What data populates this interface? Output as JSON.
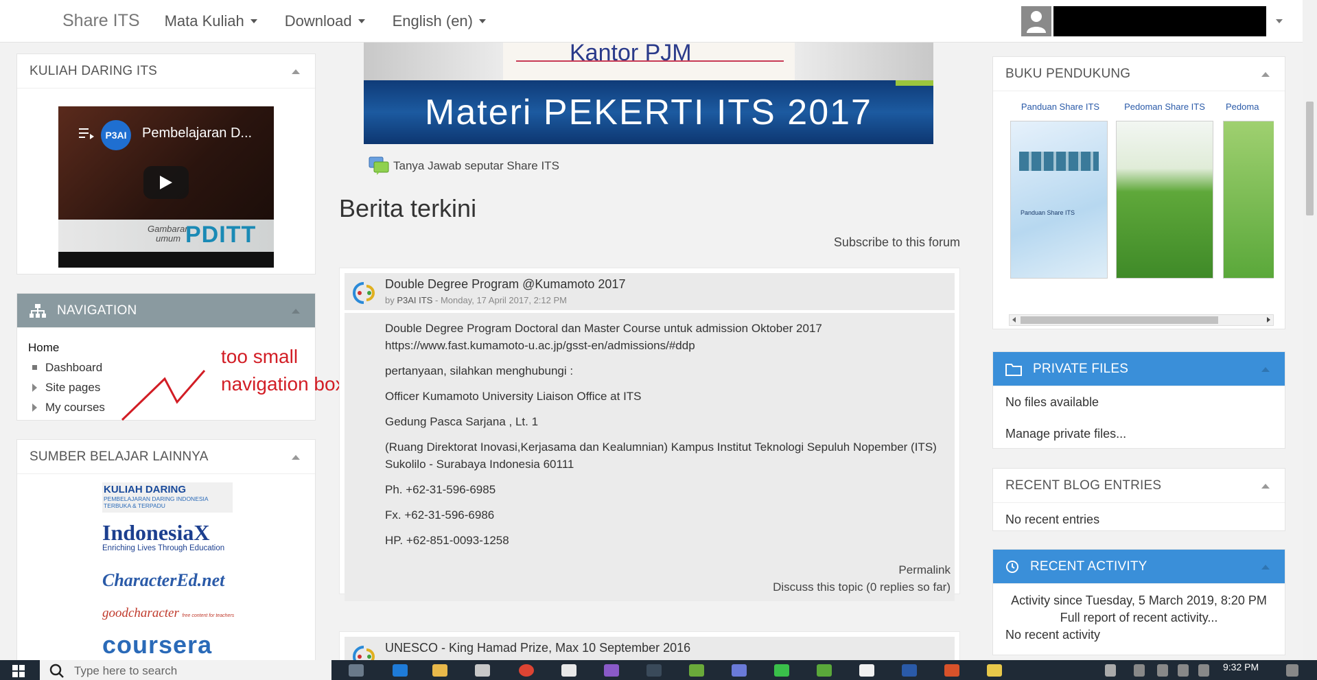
{
  "navbar": {
    "brand": "Share ITS",
    "menu": [
      {
        "label": "Mata Kuliah"
      },
      {
        "label": "Download"
      },
      {
        "label": "English (en)"
      }
    ]
  },
  "left": {
    "kuliah_daring": {
      "title": "KULIAH DARING ITS",
      "video": {
        "channel": "P3AI",
        "title": "Pembelajaran D...",
        "strip_small_1": "Gambaran",
        "strip_small_2": "umum",
        "strip_big": "PDITT"
      }
    },
    "navigation": {
      "title": "NAVIGATION",
      "home": "Home",
      "items": [
        {
          "label": "Dashboard",
          "marker": "square"
        },
        {
          "label": "Site pages",
          "marker": "triangle"
        },
        {
          "label": "My courses",
          "marker": "triangle"
        }
      ]
    },
    "sumber": {
      "title": "SUMBER BELAJAR LAINNYA",
      "logos": [
        {
          "name": "KULIAH DARING",
          "sub": "PEMBELAJARAN DARING INDONESIA TERBUKA & TERPADU"
        },
        {
          "name": "IndonesiaX",
          "sub": "Enriching Lives Through Education"
        },
        {
          "name": "CharacterEd.net"
        },
        {
          "name": "goodcharacter",
          "sub": "free content for teachers"
        },
        {
          "name": "coursera"
        }
      ]
    }
  },
  "annotation": {
    "line1": "too small",
    "line2": "navigation box"
  },
  "center": {
    "banner_top_text": "Kantor PJM",
    "banner_main_text": "Materi PEKERTI ITS 2017",
    "tanya_link": "Tanya Jawab seputar Share ITS",
    "section_title": "Berita terkini",
    "subscribe": "Subscribe to this forum",
    "posts": [
      {
        "title": "Double Degree Program @Kumamoto 2017",
        "by": "by",
        "author": "P3AI ITS",
        "date": " - Monday, 17 April 2017, 2:12 PM",
        "body": [
          "Double Degree Program Doctoral dan Master Course untuk admission Oktober 2017 https://www.fast.kumamoto-u.ac.jp/gsst-en/admissions/#ddp",
          "pertanyaan, silahkan menghubungi :",
          "Officer  Kumamoto University Liaison Office at ITS",
          "Gedung Pasca Sarjana , Lt. 1",
          "(Ruang Direktorat Inovasi,Kerjasama dan Kealumnian)  Kampus Institut Teknologi Sepuluh Nopember (ITS)  Sukolilo - Surabaya  Indonesia 60111",
          "Ph. +62-31-596-6985",
          "Fx. +62-31-596-6986",
          "HP. +62-851-0093-1258"
        ],
        "permalink": "Permalink",
        "discuss": "Discuss this topic (0 replies so far)"
      },
      {
        "title": "UNESCO - King Hamad Prize, Max 10 September 2016"
      }
    ]
  },
  "right": {
    "buku": {
      "title": "BUKU PENDUKUNG",
      "books": [
        {
          "label": "Panduan Share ITS",
          "cover_text": "Panduan Share ITS"
        },
        {
          "label": "Pedoman Share ITS"
        },
        {
          "label": "Pedoma"
        }
      ]
    },
    "private_files": {
      "title": "PRIVATE FILES",
      "empty": "No files available",
      "manage": "Manage private files..."
    },
    "recent_blog": {
      "title": "RECENT BLOG ENTRIES",
      "empty": "No recent entries"
    },
    "recent_activity": {
      "title": "RECENT ACTIVITY",
      "since": "Activity since Tuesday, 5 March 2019, 8:20 PM",
      "full_report": "Full report of recent activity...",
      "empty": "No recent activity"
    }
  },
  "taskbar": {
    "search_placeholder": "Type here to search",
    "time": "9:32 PM"
  },
  "colors": {
    "nav_header": "#8a9aa0",
    "blue_header": "#3a8fd9",
    "annotation": "#d21d25"
  }
}
